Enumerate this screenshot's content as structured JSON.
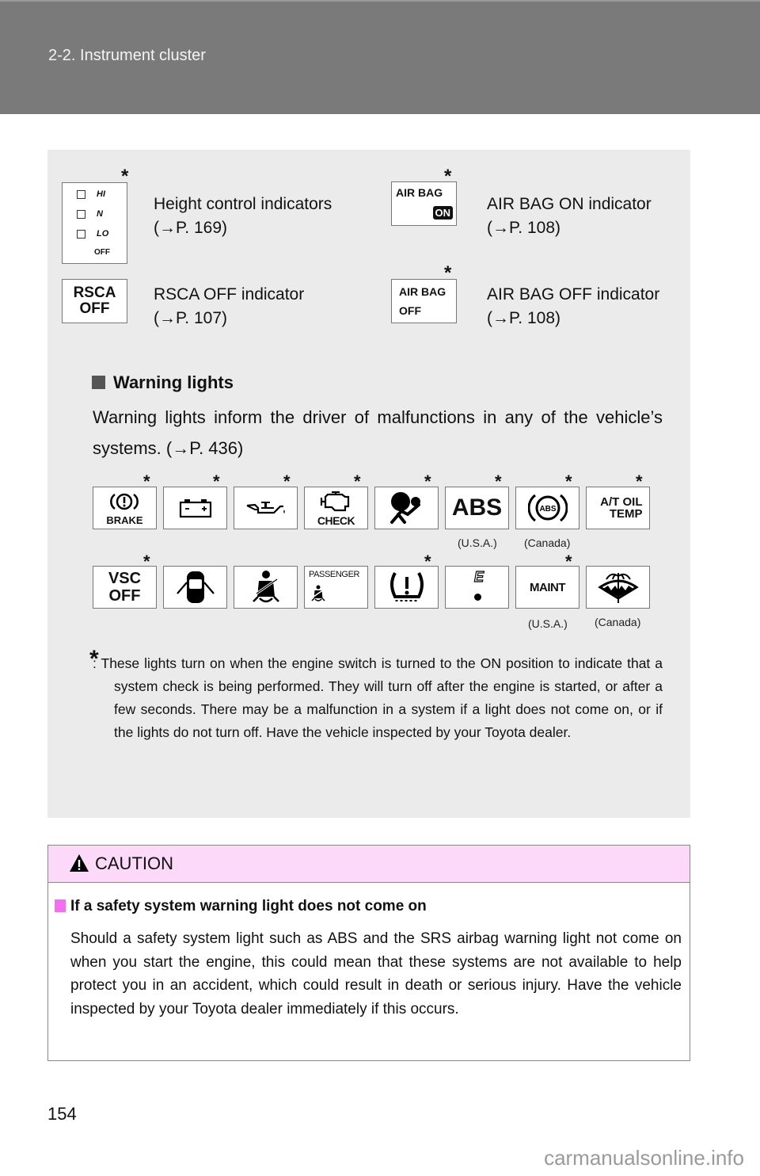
{
  "header": {
    "section_title": "2-2. Instrument cluster"
  },
  "indicators": [
    {
      "name": "height-control",
      "label": "Height control indicators",
      "ref": "(→P. 169)",
      "asterisk": "*",
      "icon_rows": [
        "HI",
        "N",
        "LO"
      ],
      "icon_off": "OFF"
    },
    {
      "name": "airbag-on",
      "label": "AIR BAG ON indicator",
      "ref": "(→P. 108)",
      "asterisk": "*",
      "icon_top": "AIR BAG",
      "icon_badge": "ON"
    },
    {
      "name": "rsca-off",
      "label": "RSCA OFF indicator",
      "ref": "(→P. 107)",
      "asterisk": "",
      "icon_line1": "RSCA",
      "icon_line2": "OFF"
    },
    {
      "name": "airbag-off",
      "label": "AIR BAG OFF indicator",
      "ref": "(→P. 108)",
      "asterisk": "*",
      "icon_top": "AIR BAG",
      "icon_bottom": "OFF"
    }
  ],
  "warning_section": {
    "title": "Warning lights",
    "body": "Warning lights inform the driver of malfunctions in any of the vehicle’s systems. (→P. 436)"
  },
  "warning_lights": {
    "row1": [
      {
        "icon": "brake-warning-icon",
        "text": "BRAKE",
        "asterisk": "*",
        "region": ""
      },
      {
        "icon": "battery-charge-icon",
        "text": "",
        "asterisk": "*",
        "region": ""
      },
      {
        "icon": "oil-pressure-icon",
        "text": "",
        "asterisk": "*",
        "region": ""
      },
      {
        "icon": "check-engine-icon",
        "text": "CHECK",
        "asterisk": "*",
        "region": ""
      },
      {
        "icon": "srs-airbag-icon",
        "text": "",
        "asterisk": "*",
        "region": ""
      },
      {
        "icon": "abs-text-icon",
        "text": "ABS",
        "asterisk": "*",
        "region": "(U.S.A.)"
      },
      {
        "icon": "abs-circle-icon",
        "text": "ABS",
        "asterisk": "*",
        "region": "(Canada)"
      },
      {
        "icon": "at-oil-temp-icon",
        "text": "A/T OIL TEMP",
        "asterisk": "*",
        "region": ""
      }
    ],
    "row2": [
      {
        "icon": "vsc-off-icon",
        "text": "VSC OFF",
        "asterisk": "*",
        "region": ""
      },
      {
        "icon": "door-open-icon",
        "text": "",
        "asterisk": "",
        "region": ""
      },
      {
        "icon": "seatbelt-icon",
        "text": "",
        "asterisk": "",
        "region": ""
      },
      {
        "icon": "passenger-seatbelt-icon",
        "text": "PASSENGER",
        "asterisk": "",
        "region": ""
      },
      {
        "icon": "tire-pressure-icon",
        "text": "",
        "asterisk": "*",
        "region": ""
      },
      {
        "icon": "low-fuel-icon",
        "text": "E",
        "asterisk": "",
        "region": ""
      },
      {
        "icon": "maint-icon",
        "text": "MAINT",
        "asterisk": "*",
        "region": "(U.S.A.)"
      },
      {
        "icon": "washer-fluid-icon",
        "text": "",
        "asterisk": "",
        "region": "(Canada)"
      }
    ]
  },
  "footnote": {
    "marker": "*",
    "text": ": These lights turn on when the engine switch is turned to the ON position to indicate that a system check is being performed. They will turn off after the engine is started, or after a few seconds. There may be a malfunction in a system if a light does not come on, or if the lights do not turn off. Have the vehicle inspected by your Toyota dealer."
  },
  "caution": {
    "title": "CAUTION",
    "subtitle": "If a safety system warning light does not come on",
    "body": "Should a safety system light such as ABS and the SRS airbag warning light not come on when you start the engine, this could mean that these systems are not available to help protect you in an accident, which could result in death or serious injury. Have the vehicle inspected by your Toyota dealer immediately if this occurs.",
    "colors": {
      "header_bg": "#fcd9f8",
      "marker": "#f36ef0"
    }
  },
  "footer": {
    "page_number": "154",
    "watermark": "carmanualsonline.info"
  }
}
